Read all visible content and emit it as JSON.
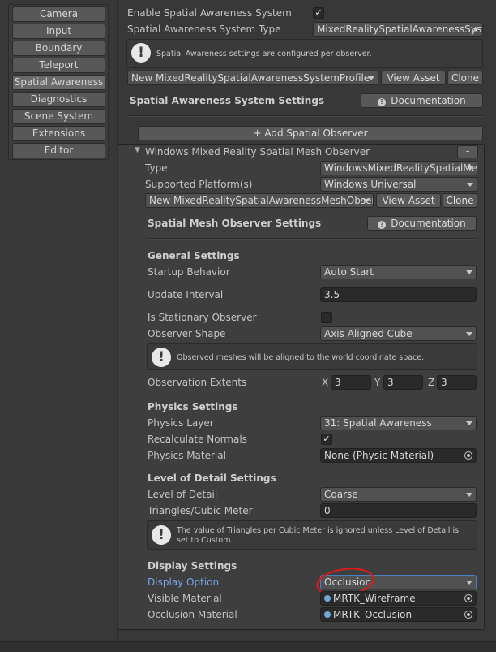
{
  "menu": {
    "items": [
      {
        "label": "Camera",
        "selected": false
      },
      {
        "label": "Input",
        "selected": false
      },
      {
        "label": "Boundary",
        "selected": false
      },
      {
        "label": "Teleport",
        "selected": false
      },
      {
        "label": "Spatial Awareness",
        "selected": true
      },
      {
        "label": "Diagnostics",
        "selected": false
      },
      {
        "label": "Scene System",
        "selected": false
      },
      {
        "label": "Extensions",
        "selected": false
      },
      {
        "label": "Editor",
        "selected": false
      }
    ]
  },
  "system": {
    "enable_label": "Enable Spatial Awareness System",
    "enable_checked": "✓",
    "type_label": "Spatial Awareness System Type",
    "type_value": "MixedRealitySpatialAwarenessSystem",
    "help_text": "Spatial Awareness settings are configured per observer.",
    "profile_value": "New MixedRealitySpatialAwarenessSystemProfile",
    "view_asset": "View Asset",
    "clone": "Clone",
    "settings_title": "Spatial Awareness System Settings",
    "documentation": "Documentation",
    "add_observer": "+ Add Spatial Observer"
  },
  "observer": {
    "title": "Windows Mixed Reality Spatial Mesh Observer",
    "remove": "-",
    "type_label": "Type",
    "type_value": "WindowsMixedRealitySpatialMeshObserver",
    "platform_label": "Supported Platform(s)",
    "platform_value": "Windows Universal",
    "profile_value": "New MixedRealitySpatialAwarenessMeshObserverProfile",
    "view_asset": "View Asset",
    "clone": "Clone",
    "settings_title": "Spatial Mesh Observer Settings",
    "documentation": "Documentation",
    "general": {
      "heading": "General Settings",
      "startup_label": "Startup Behavior",
      "startup_value": "Auto Start",
      "interval_label": "Update Interval",
      "interval_value": "3.5",
      "stationary_label": "Is Stationary Observer",
      "shape_label": "Observer Shape",
      "shape_value": "Axis Aligned Cube",
      "help_text": "Observed meshes will be aligned to the world coordinate space.",
      "extents_label": "Observation Extents",
      "x_label": "X",
      "x_value": "3",
      "y_label": "Y",
      "y_value": "3",
      "z_label": "Z",
      "z_value": "3"
    },
    "physics": {
      "heading": "Physics Settings",
      "layer_label": "Physics Layer",
      "layer_value": "31: Spatial Awareness",
      "normals_label": "Recalculate Normals",
      "normals_checked": "✓",
      "material_label": "Physics Material",
      "material_value": "None (Physic Material)"
    },
    "lod": {
      "heading": "Level of Detail Settings",
      "lod_label": "Level of Detail",
      "lod_value": "Coarse",
      "tri_label": "Triangles/Cubic Meter",
      "tri_value": "0",
      "help_line1": "The value of Triangles per Cubic Meter is ignored unless Level of Detail is",
      "help_line2": "set to Custom."
    },
    "display": {
      "heading": "Display Settings",
      "option_label": "Display Option",
      "option_value": "Occlusion",
      "visible_label": "Visible Material",
      "visible_value": "MRTK_Wireframe",
      "occlusion_label": "Occlusion Material",
      "occlusion_value": "MRTK_Occlusion"
    }
  },
  "colors": {
    "highlight_label": "#7aa6e8",
    "annotation_circle": "#d91c1c"
  }
}
